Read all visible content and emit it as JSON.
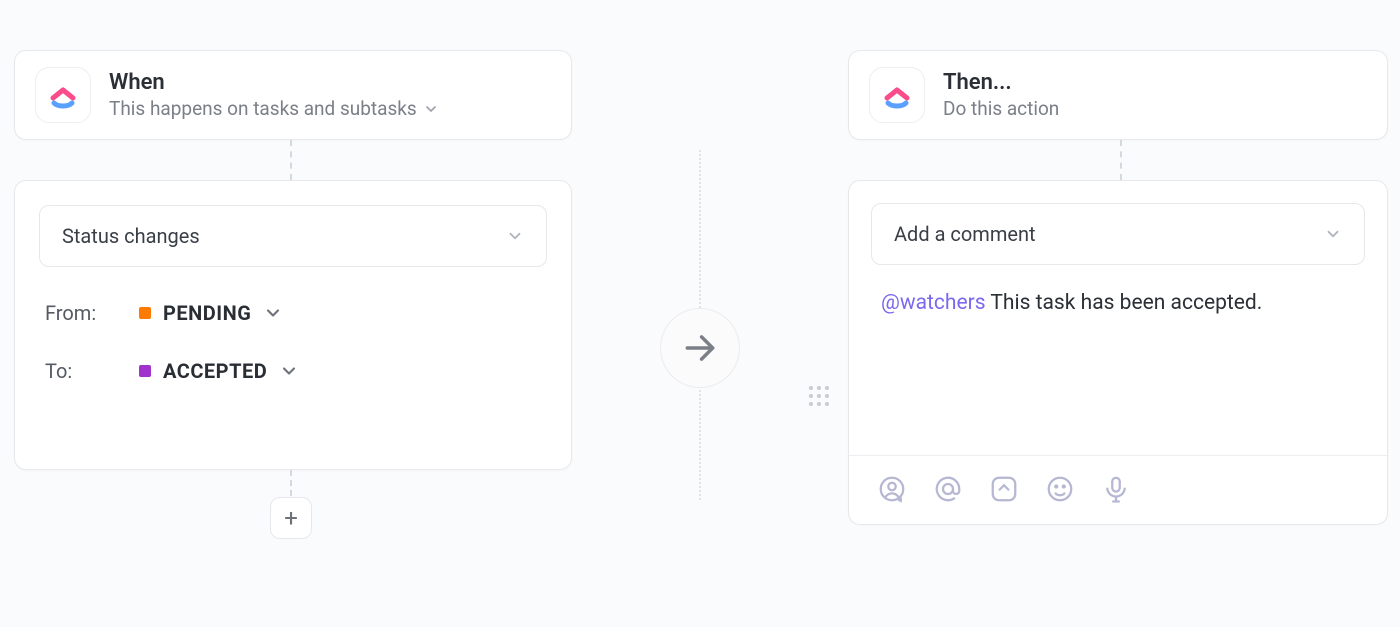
{
  "when": {
    "title": "When",
    "subtitle": "This happens on tasks and subtasks"
  },
  "then": {
    "title": "Then...",
    "subtitle": "Do this action"
  },
  "trigger": {
    "type_label": "Status changes",
    "from_label": "From:",
    "from_status": "PENDING",
    "from_color": "#ff7a00",
    "to_label": "To:",
    "to_status": "ACCEPTED",
    "to_color": "#a033cc"
  },
  "action": {
    "type_label": "Add a comment",
    "comment_mention": "@watchers",
    "comment_text": " This task has been accepted."
  },
  "icons": {
    "add": "+",
    "arrow": "arrow-right-icon",
    "person": "person-speech-icon",
    "at": "at-icon",
    "record": "record-clip-icon",
    "emoji": "emoji-icon",
    "mic": "mic-icon"
  }
}
